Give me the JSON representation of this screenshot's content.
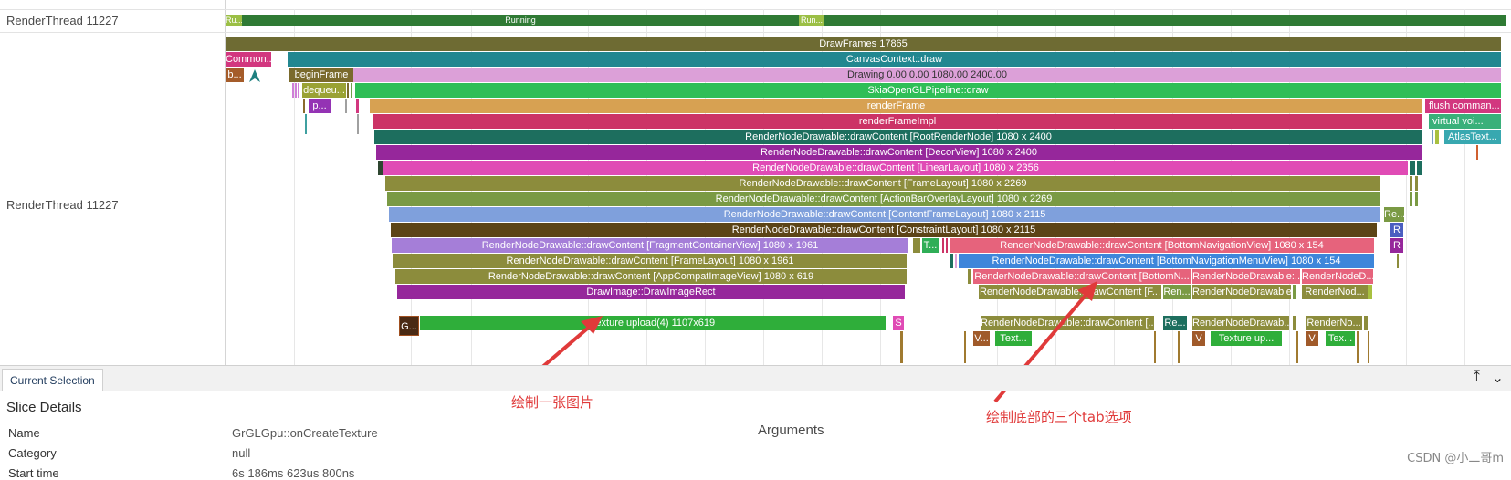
{
  "tracks": {
    "top_label": "RenderThread 11227",
    "main_label": "RenderThread 11227"
  },
  "state_bar": {
    "running_label": "Running",
    "short_left": "Ru...",
    "short_mid": "Run..."
  },
  "slices": {
    "draw_frames": "DrawFrames 17865",
    "common": "Common...",
    "canvas_draw": "CanvasContext::draw",
    "b": "b...",
    "begin_frame": "beginFrame",
    "drawing": "Drawing  0.00  0.00 1080.00 2400.00",
    "dequeue": "dequeu...",
    "skia_pipeline": "SkiaOpenGLPipeline::draw",
    "p": "p...",
    "render_frame": "renderFrame",
    "flush_commands": "flush comman...",
    "render_frame_impl": "renderFrameImpl",
    "virtual_void": "virtual voi...",
    "atlas_text": "AtlasText...",
    "root_render_node": "RenderNodeDrawable::drawContent [RootRenderNode] 1080 x 2400",
    "decor_view": "RenderNodeDrawable::drawContent [DecorView] 1080 x 2400",
    "linear_layout": "RenderNodeDrawable::drawContent [LinearLayout] 1080 x 2356",
    "frame_layout_2269": "RenderNodeDrawable::drawContent [FrameLayout] 1080 x 2269",
    "action_bar_overlay": "RenderNodeDrawable::drawContent [ActionBarOverlayLayout] 1080 x 2269",
    "content_frame_layout": "RenderNodeDrawable::drawContent [ContentFrameLayout] 1080 x 2115",
    "re": "Re...",
    "constraint_layout": "RenderNodeDrawable::drawContent [ConstraintLayout] 1080 x 2115",
    "r1": "R",
    "fragment_container": "RenderNodeDrawable::drawContent [FragmentContainerView] 1080 x 1961",
    "t_small": "T...",
    "bottom_nav_view": "RenderNodeDrawable::drawContent [BottomNavigationView] 1080 x 154",
    "r2": "R",
    "frame_layout_1961": "RenderNodeDrawable::drawContent [FrameLayout] 1080 x 1961",
    "bottom_nav_menu": "RenderNodeDrawable::drawContent [BottomNavigationMenuView] 1080 x 154",
    "app_compat_image": "RenderNodeDrawable::drawContent [AppCompatImageView] 1080 x 619",
    "bottom_n": "RenderNodeDrawable::drawContent [BottomN...",
    "rnd_drawab1": "RenderNodeDrawable:...",
    "rnd_d": "RenderNodeD...",
    "draw_image_rect": "DrawImage::DrawImageRect",
    "rnd_f": "RenderNodeDrawable::drawContent [F...",
    "ren": "Ren...",
    "rnd_drawab2": "RenderNodeDrawable:...",
    "render_nod1": "RenderNod...",
    "g": "G...",
    "texture_upload": "Texture upload(4) 1107x619",
    "s": "S",
    "rnd_bracket": "RenderNodeDrawable::drawContent [...",
    "re2": "Re...",
    "rnd_drawab3": "RenderNodeDrawab...",
    "render_nod2": "RenderNo...",
    "v1": "V...",
    "text1": "Text...",
    "v2": "V",
    "texture_up2": "Texture up...",
    "v3": "V",
    "tex": "Tex..."
  },
  "panel": {
    "tab_label": "Current Selection",
    "title": "Slice Details",
    "arguments_label": "Arguments",
    "rows": [
      {
        "key": "Name",
        "value": "GrGLGpu::onCreateTexture"
      },
      {
        "key": "Category",
        "value": "null"
      },
      {
        "key": "Start time",
        "value": "6s 186ms 623us 800ns"
      }
    ]
  },
  "annotations": {
    "left": "绘制一张图片",
    "right": "绘制底部的三个tab选项"
  },
  "watermark": "CSDN @小二哥m",
  "colors": {
    "running": "#2f7a34",
    "annotation": "#e03a3a"
  }
}
